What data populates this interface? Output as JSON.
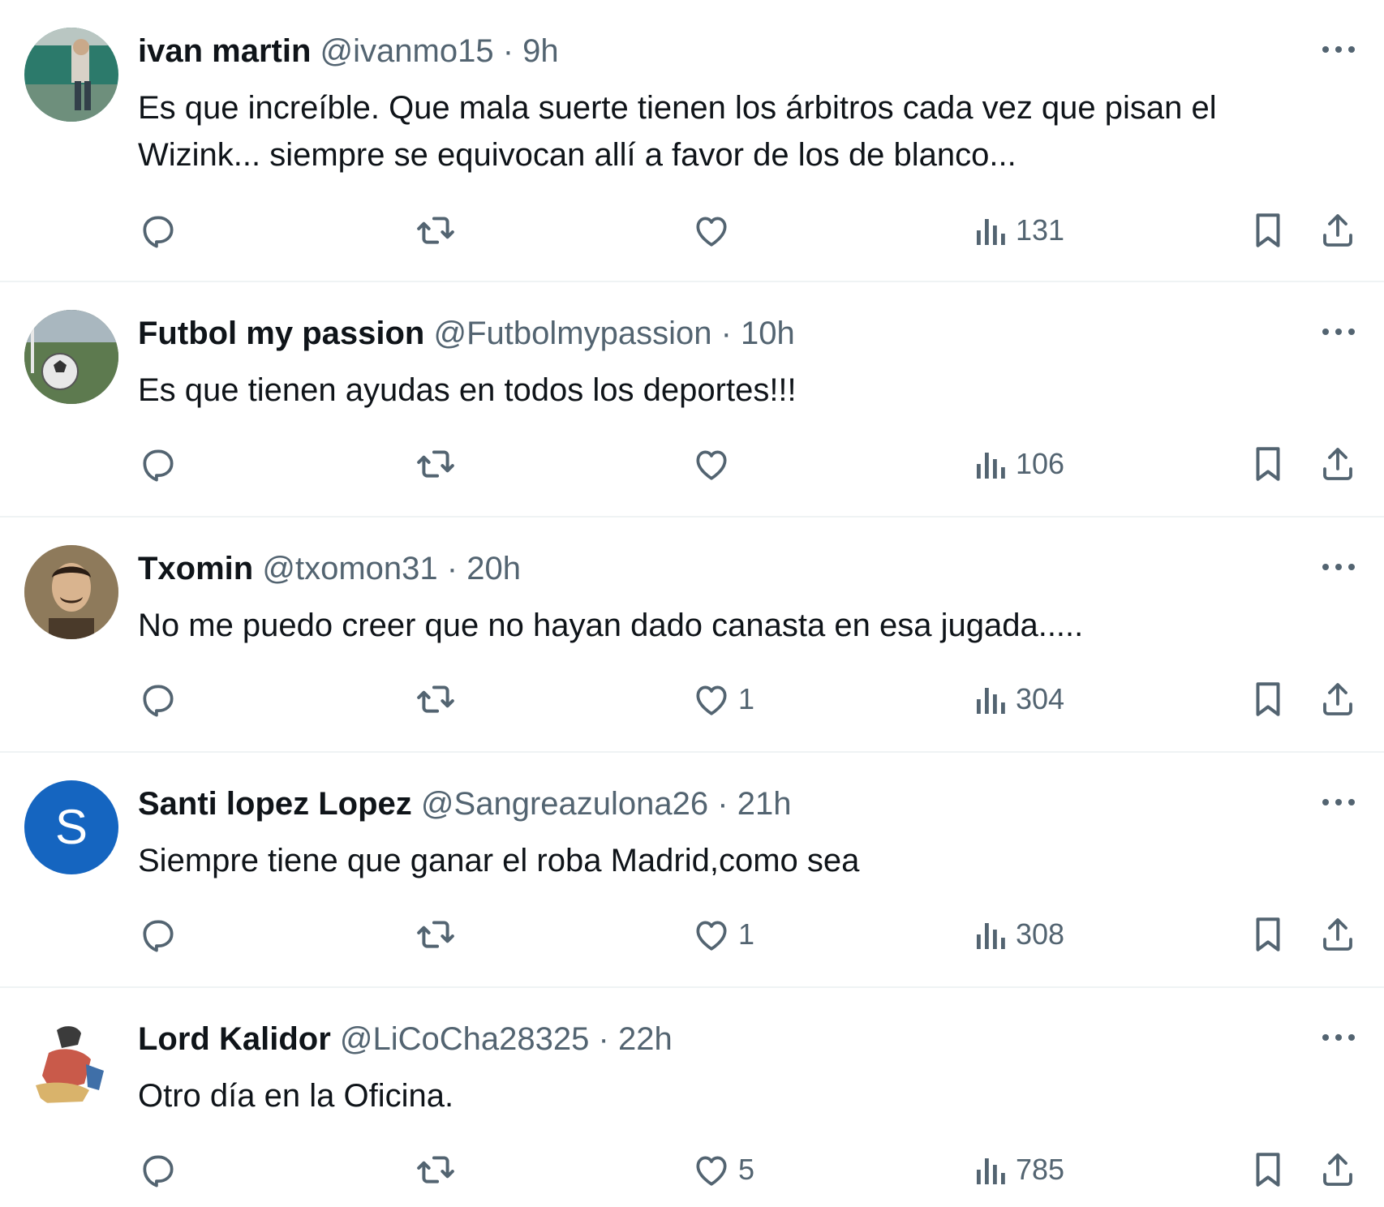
{
  "tweets": [
    {
      "name": "ivan martin",
      "handle": "@ivanmo15",
      "time": "9h",
      "text": "Es que increíble. Que mala suerte tienen los árbitros cada vez que pisan el Wizink... siempre se equivocan allí a favor de los de blanco...",
      "likes": "",
      "views": "131",
      "avatar": "photo-outdoor"
    },
    {
      "name": "Futbol my passion",
      "handle": "@Futbolmypassion",
      "time": "10h",
      "text": "Es que tienen ayudas en todos los deportes!!!",
      "likes": "",
      "views": "106",
      "avatar": "photo-football"
    },
    {
      "name": "Txomin",
      "handle": "@txomon31",
      "time": "20h",
      "text": "No me puedo creer que no hayan dado canasta en esa jugada.....",
      "likes": "1",
      "views": "304",
      "avatar": "photo-portrait"
    },
    {
      "name": "Santi lopez Lopez",
      "handle": "@Sangreazulona26",
      "time": "21h",
      "text": "Siempre tiene que ganar el roba Madrid,como sea",
      "likes": "1",
      "views": "308",
      "avatar": "letter",
      "avatar_letter": "S",
      "avatar_color": "#1565c0"
    },
    {
      "name": "Lord Kalidor",
      "handle": "@LiCoCha28325",
      "time": "22h",
      "text": "Otro día en la Oficina.",
      "likes": "5",
      "views": "785",
      "avatar": "photo-illustration"
    }
  ],
  "separator": "·",
  "icons": {
    "reply": "reply-icon",
    "retweet": "retweet-icon",
    "like": "heart-icon",
    "views": "views-icon",
    "bookmark": "bookmark-icon",
    "share": "share-icon",
    "more": "more-icon"
  },
  "colors": {
    "text": "#0f1419",
    "secondary": "#536471",
    "divider": "#eff3f4"
  }
}
